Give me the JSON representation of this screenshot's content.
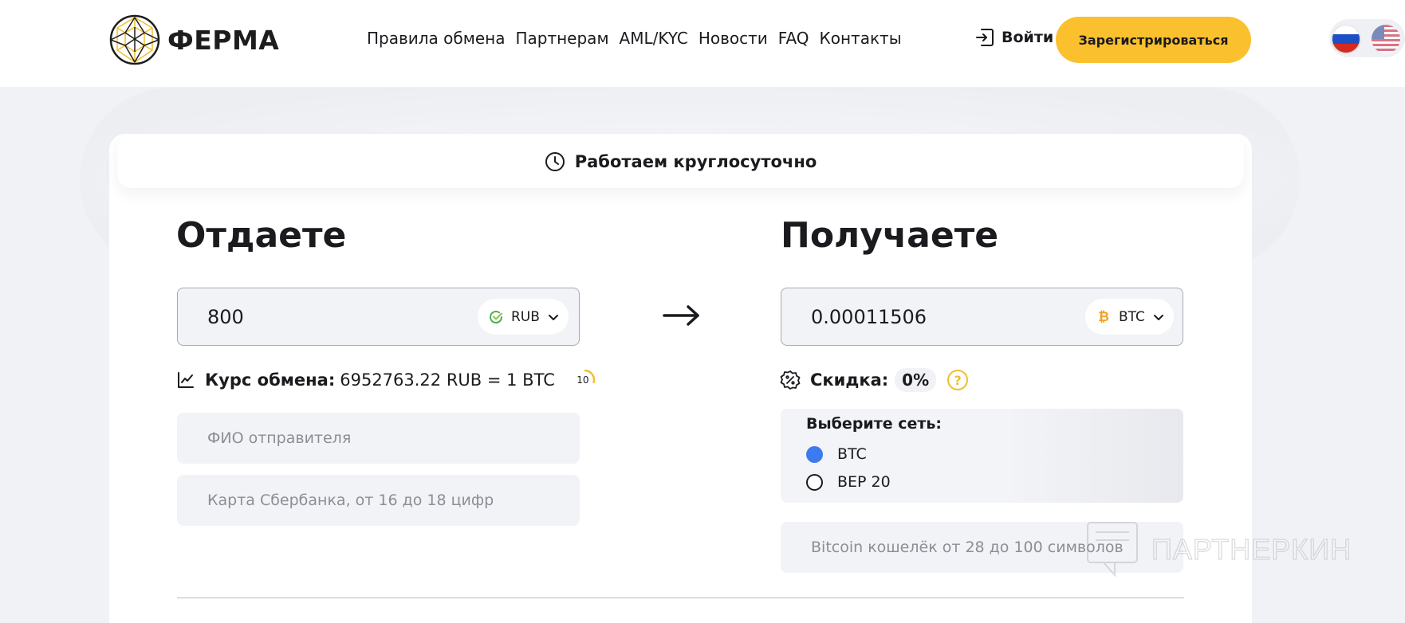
{
  "header": {
    "logo_text": "ФЕРМА",
    "nav": [
      "Правила обмена",
      "Партнерам",
      "AML/KYC",
      "Новости",
      "FAQ",
      "Контакты"
    ],
    "login_label": "Войти",
    "register_label": "Зарегистрироваться"
  },
  "banner": {
    "text": "Работаем круглосуточно",
    "icon": "clock-icon"
  },
  "give": {
    "title": "Отдаете",
    "amount": "800",
    "currency": "RUB",
    "rate_label": "Курс обмена:",
    "rate_value": "6952763.22 RUB = 1 BTC",
    "timer": "10",
    "timer_progress": 0.3,
    "name_placeholder": "ФИО отправителя",
    "card_placeholder": "Карта Сбербанка, от 16 до 18 цифр"
  },
  "receive": {
    "title": "Получаете",
    "amount": "0.00011506",
    "currency": "BTC",
    "discount_label": "Скидка:",
    "discount_value": "0%",
    "help": "?",
    "network_title": "Выберите сеть:",
    "networks": [
      {
        "label": "BTC",
        "selected": true
      },
      {
        "label": "BEP 20",
        "selected": false
      }
    ],
    "wallet_placeholder": "Bitcoin кошелёк от 28 до 100 символов"
  },
  "watermark": "ПАРТНЕРКИН",
  "colors": {
    "accent": "#fbc02d",
    "radio_selected": "#3b7bef",
    "bitcoin": "#f2a01f",
    "rub_check": "#4caf50"
  }
}
